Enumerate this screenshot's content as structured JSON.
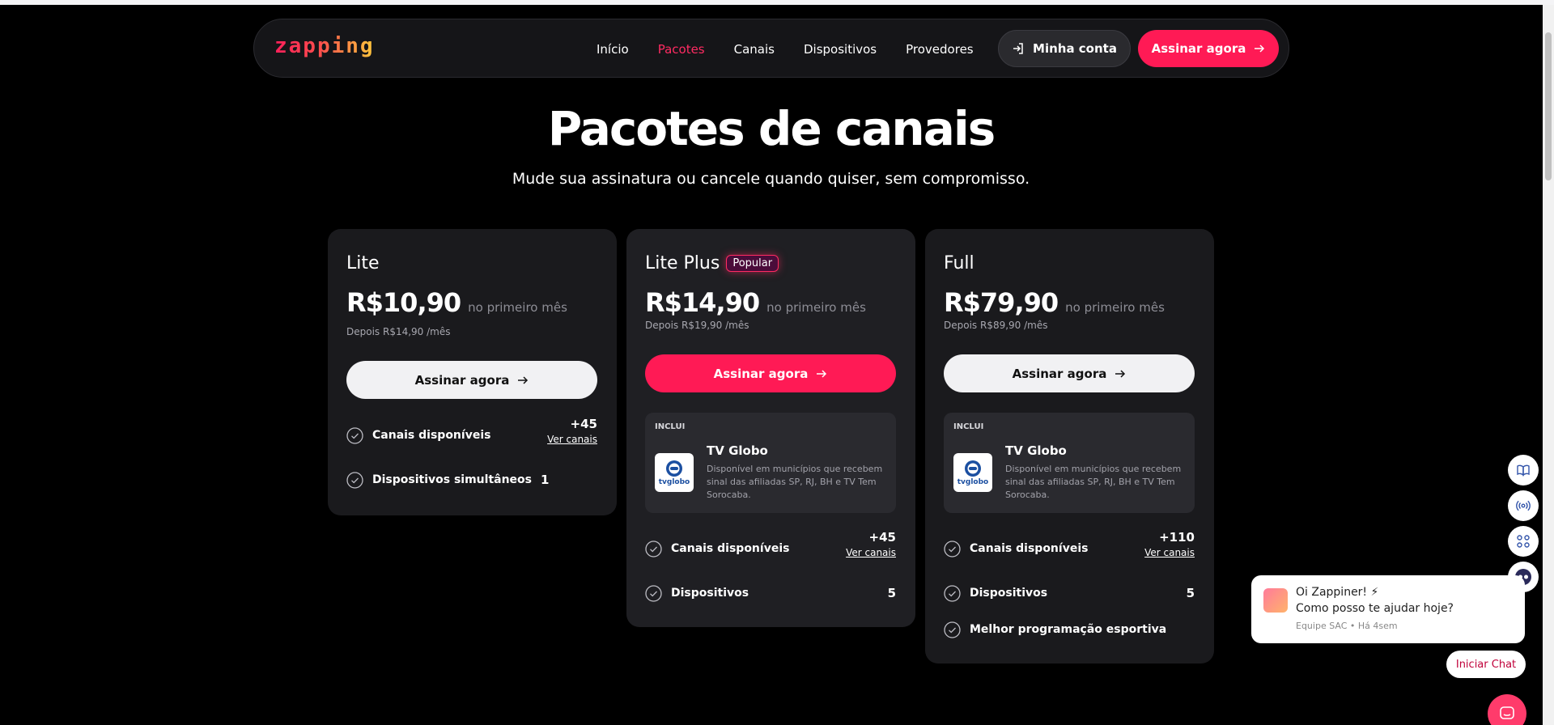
{
  "header": {
    "logo": "zapping",
    "nav": [
      "Início",
      "Pacotes",
      "Canais",
      "Dispositivos",
      "Provedores"
    ],
    "active_nav": "Pacotes",
    "account_label": "Minha conta",
    "subscribe_label": "Assinar agora"
  },
  "hero": {
    "title": "Pacotes de canais",
    "subtitle": "Mude sua assinatura ou cancele quando quiser, sem compromisso."
  },
  "plans": [
    {
      "name": "Lite",
      "price": "R$10,90",
      "price_note": "no primeiro mês",
      "after": "Depois R$14,90 /mês",
      "cta": "Assinar agora",
      "features": [
        {
          "label": "Canais disponíveis",
          "value": "+45",
          "link": "Ver canais"
        },
        {
          "label": "Dispositivos simultâneos",
          "value": "1"
        }
      ]
    },
    {
      "name": "Lite Plus",
      "badge": "Popular",
      "price": "R$14,90",
      "price_note": "no primeiro mês",
      "after": "Depois R$19,90 /mês",
      "cta": "Assinar agora",
      "includes": {
        "label": "INCLUI",
        "logo_text": "tvglobo",
        "title": "TV Globo",
        "desc": "Disponível em municípios que recebem sinal das afiliadas SP, RJ, BH e TV Tem Sorocaba."
      },
      "features": [
        {
          "label": "Canais disponíveis",
          "value": "+45",
          "link": "Ver canais"
        },
        {
          "label": "Dispositivos",
          "value": "5"
        }
      ]
    },
    {
      "name": "Full",
      "price": "R$79,90",
      "price_note": "no primeiro mês",
      "after": "Depois R$89,90 /mês",
      "cta": "Assinar agora",
      "includes": {
        "label": "INCLUI",
        "logo_text": "tvglobo",
        "title": "TV Globo",
        "desc": "Disponível em municípios que recebem sinal das afiliadas SP, RJ, BH e TV Tem Sorocaba."
      },
      "features": [
        {
          "label": "Canais disponíveis",
          "value": "+110",
          "link": "Ver canais"
        },
        {
          "label": "Dispositivos",
          "value": "5"
        },
        {
          "label": "Melhor programação esportiva"
        }
      ]
    }
  ],
  "chat": {
    "greeting": "Oi Zappiner! ⚡",
    "question": "Como posso te ajudar hoje?",
    "meta": "Equipe SAC • Há 4sem",
    "start_label": "Iniciar Chat"
  },
  "colors": {
    "accent": "#ff1a55",
    "background": "#000000",
    "card": "#1a1a1d"
  }
}
